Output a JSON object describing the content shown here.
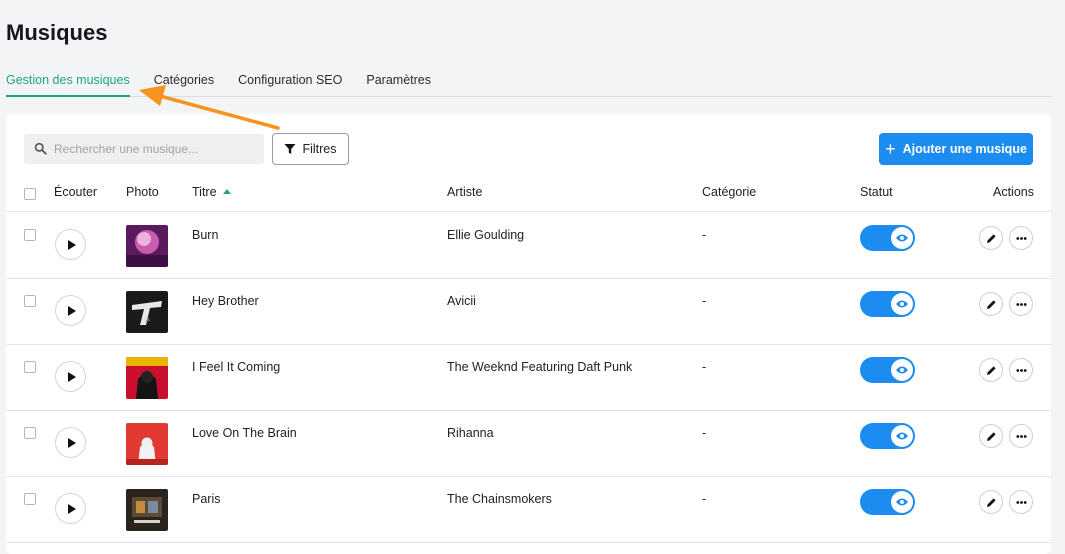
{
  "page": {
    "title": "Musiques"
  },
  "tabs": [
    {
      "label": "Gestion des musiques",
      "active": true
    },
    {
      "label": "Catégories",
      "active": false
    },
    {
      "label": "Configuration SEO",
      "active": false
    },
    {
      "label": "Paramètres",
      "active": false
    }
  ],
  "toolbar": {
    "search_placeholder": "Rechercher une musique...",
    "search_icon": "search-icon",
    "filters_label": "Filtres",
    "filters_icon": "funnel-icon",
    "add_label": "Ajouter une musique",
    "add_icon": "plus-icon"
  },
  "table": {
    "columns": {
      "listen": "Écouter",
      "photo": "Photo",
      "title": "Titre",
      "artist": "Artiste",
      "category": "Catégorie",
      "status": "Statut",
      "actions": "Actions"
    },
    "sort": {
      "column": "title",
      "direction": "asc"
    },
    "rows": [
      {
        "title": "Burn",
        "artist": "Ellie Goulding",
        "category": "-",
        "status_on": true,
        "thumb": "cover-halcyon"
      },
      {
        "title": "Hey Brother",
        "artist": "Avicii",
        "category": "-",
        "status_on": true,
        "thumb": "cover-true"
      },
      {
        "title": "I Feel It Coming",
        "artist": "The Weeknd Featuring Daft Punk",
        "category": "-",
        "status_on": true,
        "thumb": "cover-starboy"
      },
      {
        "title": "Love On The Brain",
        "artist": "Rihanna",
        "category": "-",
        "status_on": true,
        "thumb": "cover-anti"
      },
      {
        "title": "Paris",
        "artist": "The Chainsmokers",
        "category": "-",
        "status_on": true,
        "thumb": "cover-memories"
      }
    ]
  },
  "colors": {
    "accent": "#1fa67a",
    "primary": "#1c8cf0",
    "annotation_arrow": "#f7931e"
  }
}
